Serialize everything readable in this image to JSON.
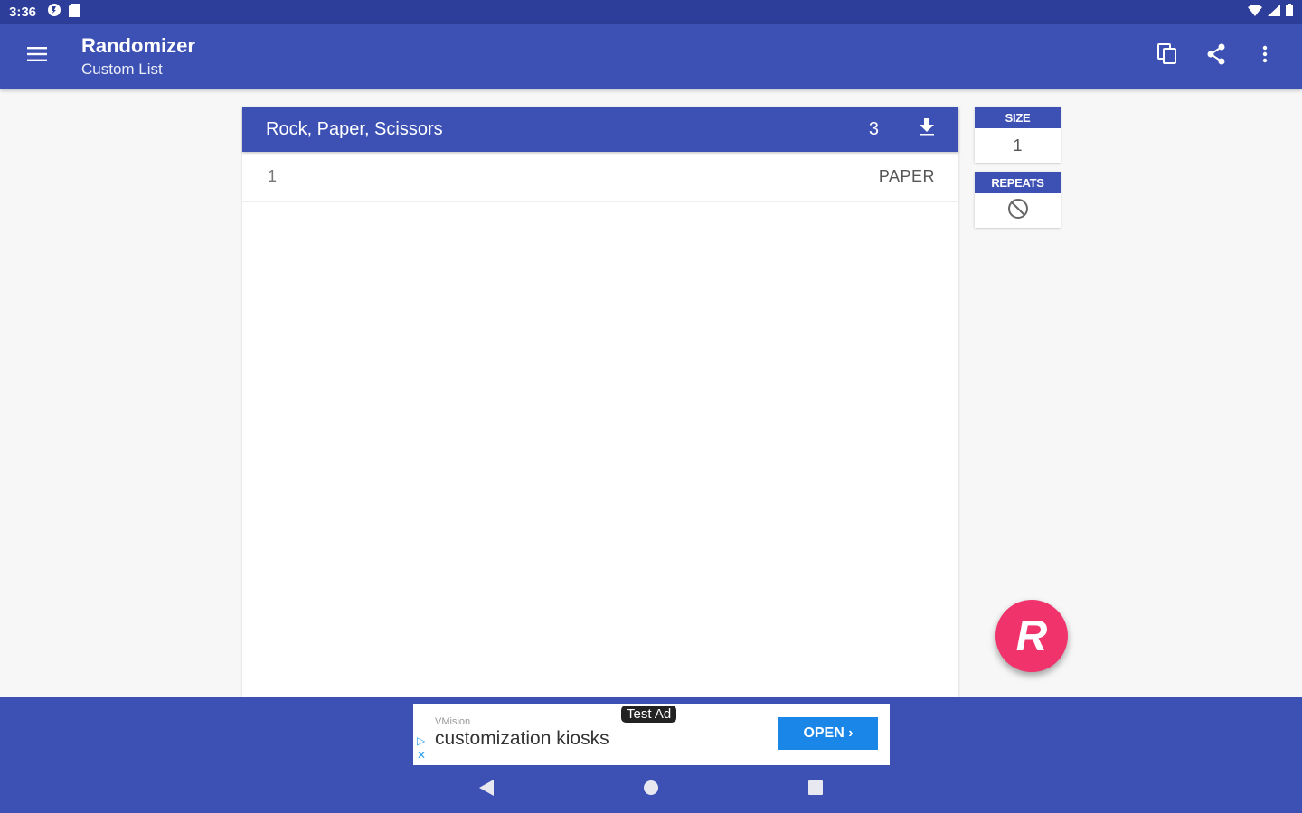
{
  "status_bar": {
    "time": "3:36"
  },
  "app_bar": {
    "title": "Randomizer",
    "subtitle": "Custom List"
  },
  "list": {
    "name": "Rock, Paper, Scissors",
    "count": "3",
    "results": [
      {
        "index": "1",
        "value": "PAPER"
      }
    ]
  },
  "settings": {
    "size_label": "SIZE",
    "size_value": "1",
    "repeats_label": "REPEATS"
  },
  "fab": {
    "label": "R"
  },
  "ad": {
    "tag": "Test Ad",
    "brand": "VMision",
    "text": "customization kiosks",
    "open_label": "OPEN ›"
  },
  "colors": {
    "primary": "#3d51b5",
    "status_bar": "#2c3e99",
    "accent": "#f0336b",
    "ad_button": "#1a87e8"
  }
}
